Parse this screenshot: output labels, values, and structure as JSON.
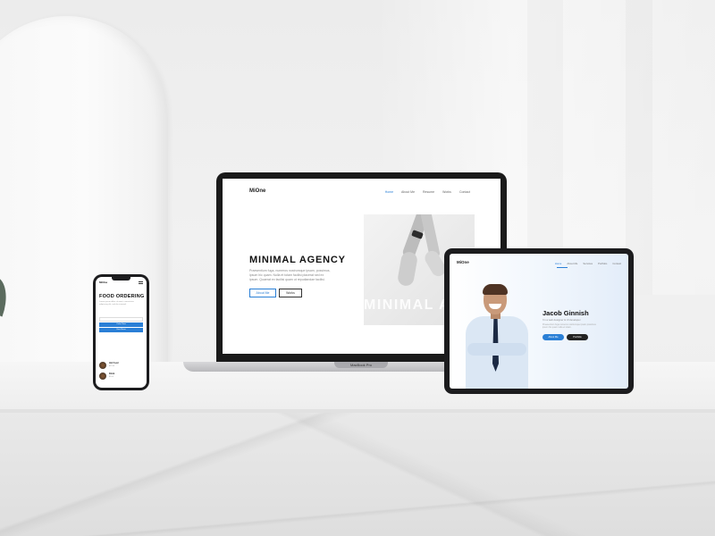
{
  "laptop": {
    "brand_label": "MacBook Pro",
    "site": {
      "logo": "MiOne",
      "nav": [
        "Home",
        "About Me",
        "Resume",
        "Works",
        "Contact"
      ],
      "hero_title": "MINIMAL AGENCY",
      "hero_text": "Praesentium fuga, numeros nostrumque ipsam, possimus, ipsum hic quam. Nulla et totam facilisi placerat sed ex ipsum. Quaerat ex facilisi quam ut repudiandae facilisi.",
      "button_about": "About Me",
      "button_works": "Works",
      "hero_watermark": "MINIMAL AGENCY"
    }
  },
  "tablet": {
    "site": {
      "logo": "MiOne",
      "nav": [
        "Home",
        "About Me",
        "Services",
        "Portfolio",
        "Contact"
      ],
      "name": "Jacob Ginnish",
      "subtitle": "I'm a web designer & UI developer",
      "description": "Praesentium fuga numeros nostrumque ipsam possimus ipsum hic quam nulla et totam.",
      "button_primary": "About Me",
      "button_secondary": "Portfolio"
    }
  },
  "phone": {
    "site": {
      "logo": "MiOne",
      "title": "FOOD ORDERING",
      "text": "Lorem ipsum dolor sit amet, consectetur adipiscing elit, sed do eiusmod.",
      "button_1": "Order Now",
      "button_2": "View Menu",
      "items": [
        {
          "name": "Hot Food",
          "price": "$12.00"
        },
        {
          "name": "Drink",
          "price": "$5.00"
        }
      ]
    }
  },
  "colors": {
    "accent": "#2a7fd6",
    "dark": "#1c1c1e",
    "wall": "#ececec"
  }
}
